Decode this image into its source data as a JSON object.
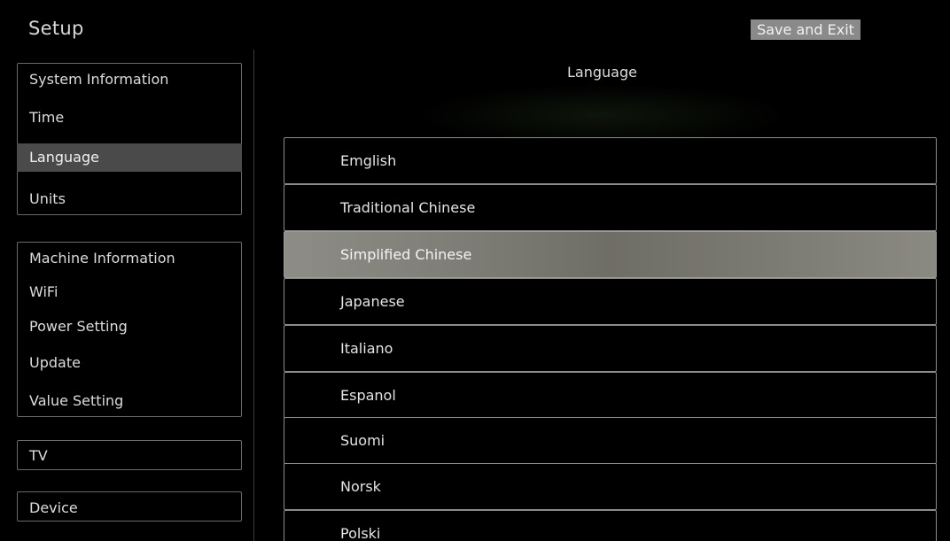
{
  "header": {
    "title": "Setup",
    "save_exit_label": "Save and Exit"
  },
  "sidebar": {
    "groups": [
      {
        "items": [
          {
            "label": "System Information",
            "active": false
          },
          {
            "label": "Time",
            "active": false
          },
          {
            "label": "Language",
            "active": true
          },
          {
            "label": "Units",
            "active": false
          }
        ]
      },
      {
        "items": [
          {
            "label": "Machine Information",
            "active": false
          },
          {
            "label": "WiFi",
            "active": false
          },
          {
            "label": "Power Setting",
            "active": false
          },
          {
            "label": "Update",
            "active": false
          },
          {
            "label": "Value Setting",
            "active": false
          }
        ]
      },
      {
        "items": [
          {
            "label": "TV",
            "active": false
          }
        ]
      },
      {
        "items": [
          {
            "label": "Device",
            "active": false
          }
        ]
      }
    ]
  },
  "main": {
    "title": "Language",
    "languages": [
      {
        "label": "Emglish",
        "selected": false
      },
      {
        "label": "Traditional Chinese",
        "selected": false
      },
      {
        "label": "Simplified Chinese",
        "selected": true
      },
      {
        "label": "Japanese",
        "selected": false
      },
      {
        "label": "Italiano",
        "selected": false
      },
      {
        "label": "Espanol",
        "selected": false
      },
      {
        "label": "Suomi",
        "selected": false
      },
      {
        "label": "Norsk",
        "selected": false
      },
      {
        "label": "Polski",
        "selected": false
      }
    ]
  },
  "colors": {
    "background": "#000000",
    "active_menu": "#4a4a4a",
    "selected_row": "#7f7f78",
    "border": "#8c8c8c",
    "save_button": "#8a8a8a"
  }
}
